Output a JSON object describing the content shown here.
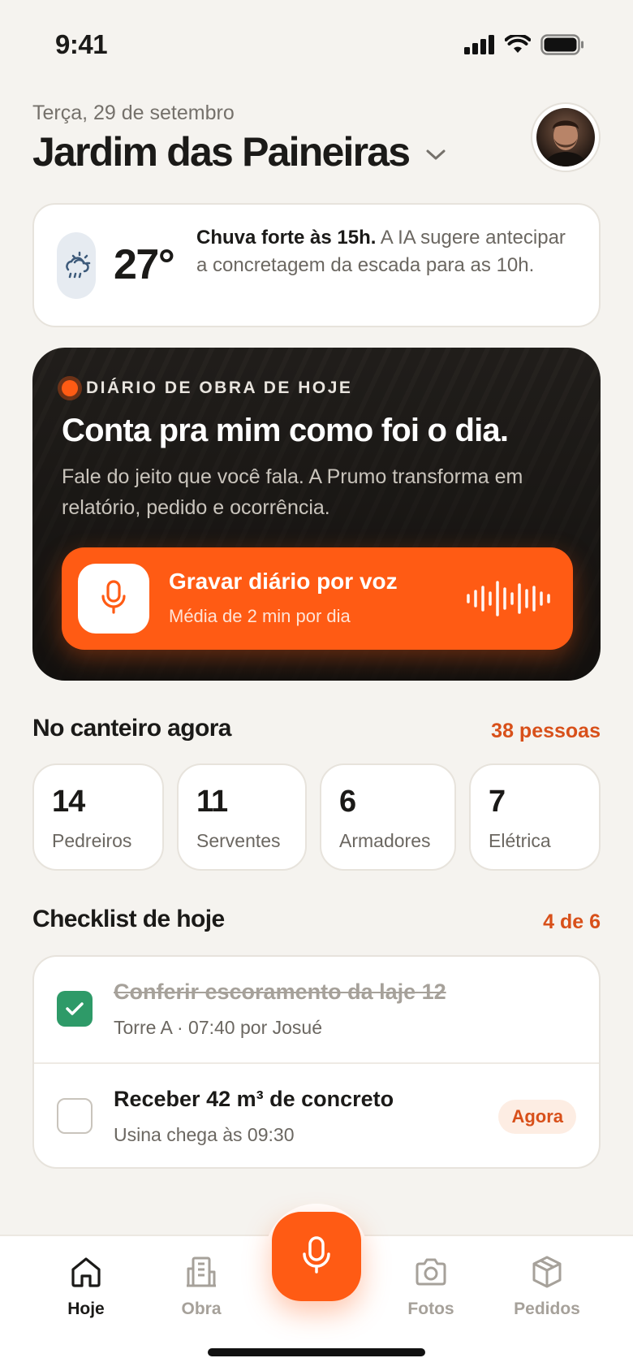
{
  "status_bar": {
    "time": "9:41"
  },
  "header": {
    "date": "Terça, 29 de setembro",
    "project_name": "Jardim das Paineiras"
  },
  "weather": {
    "temperature": "27°",
    "alert_bold": "Chuva forte às 15h.",
    "alert_rest": " A IA sugere antecipar a concretagem da escada para as 10h."
  },
  "diary": {
    "label": "DIÁRIO DE OBRA DE HOJE",
    "title": "Conta pra mim como foi o dia.",
    "subtitle": "Fale do jeito que você fala. A Prumo transforma em relatório, pedido e ocorrência.",
    "record_button": {
      "title": "Gravar diário por voz",
      "subtitle": "Média de 2 min por dia"
    }
  },
  "site_now": {
    "title": "No canteiro agora",
    "total": "38 pessoas",
    "roles": [
      {
        "count": "14",
        "label": "Pedreiros"
      },
      {
        "count": "11",
        "label": "Serventes"
      },
      {
        "count": "6",
        "label": "Armadores"
      },
      {
        "count": "7",
        "label": "Elétrica"
      }
    ]
  },
  "checklist": {
    "title": "Checklist de hoje",
    "progress": "4 de 6",
    "items": [
      {
        "title": "Conferir escoramento da laje 12",
        "subtitle": "Torre A · 07:40 por Josué",
        "done": true
      },
      {
        "title": "Receber 42 m³ de concreto",
        "subtitle": "Usina chega às 09:30",
        "done": false,
        "badge": "Agora"
      }
    ]
  },
  "bottom_nav": {
    "items": [
      {
        "label": "Hoje",
        "icon": "home-icon",
        "active": true
      },
      {
        "label": "Obra",
        "icon": "building-icon",
        "active": false
      },
      {
        "label": "Fotos",
        "icon": "camera-icon",
        "active": false
      },
      {
        "label": "Pedidos",
        "icon": "package-icon",
        "active": false
      }
    ],
    "fab_icon": "microphone-icon"
  },
  "colors": {
    "accent": "#FF5B14",
    "accent_text": "#D8501A",
    "success": "#2E9A68",
    "background": "#F5F3EF"
  }
}
